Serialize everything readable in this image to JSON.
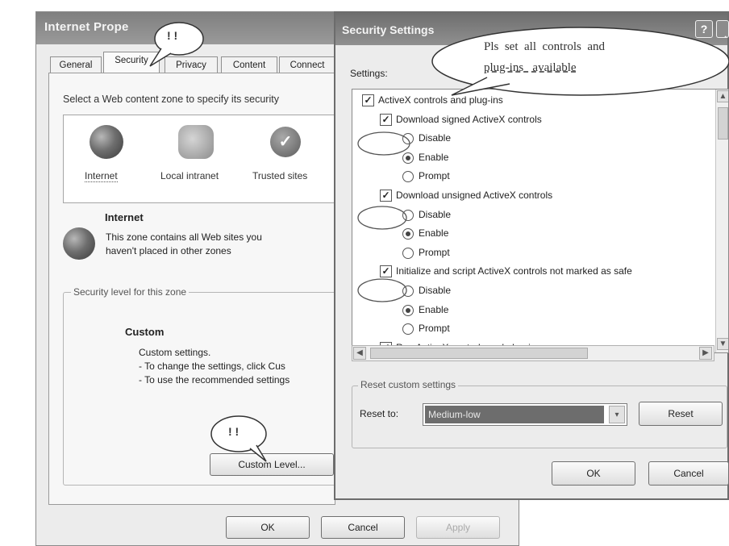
{
  "internet_properties": {
    "title": "Internet Prope",
    "tabs": [
      "General",
      "Security",
      "Privacy",
      "Content",
      "Connect"
    ],
    "active_tab": "Security",
    "zone_instruction": "Select a Web content zone to specify its security",
    "zones": [
      {
        "label": "Internet",
        "icon": "globe-icon"
      },
      {
        "label": "Local intranet",
        "icon": "monitor-icon"
      },
      {
        "label": "Trusted sites",
        "icon": "checkmark-icon"
      }
    ],
    "zone_heading": "Internet",
    "zone_description_line1": "This zone contains all Web sites you",
    "zone_description_line2": "haven't placed in other zones",
    "security_level_group": "Security level for this zone",
    "level_name": "Custom",
    "level_line1": "Custom settings.",
    "level_line2": "- To change the settings, click Cus",
    "level_line3": "- To use the recommended settings",
    "custom_level_button": "Custom Level...",
    "ok_button": "OK",
    "cancel_button": "Cancel",
    "apply_button": "Apply"
  },
  "security_settings": {
    "title": "Security Settings",
    "help_button": "?",
    "settings_label": "Settings:",
    "list": [
      {
        "kind": "category",
        "label": "ActiveX controls and plug-ins",
        "checked": true
      },
      {
        "kind": "item",
        "label": "Download signed ActiveX controls",
        "checked": true
      },
      {
        "kind": "option",
        "label": "Disable",
        "selected": false
      },
      {
        "kind": "option",
        "label": "Enable",
        "selected": true
      },
      {
        "kind": "option",
        "label": "Prompt",
        "selected": false
      },
      {
        "kind": "item",
        "label": "Download unsigned ActiveX controls",
        "checked": true
      },
      {
        "kind": "option",
        "label": "Disable",
        "selected": false
      },
      {
        "kind": "option",
        "label": "Enable",
        "selected": true
      },
      {
        "kind": "option",
        "label": "Prompt",
        "selected": false
      },
      {
        "kind": "item",
        "label": "Initialize and script ActiveX controls not marked as safe",
        "checked": true
      },
      {
        "kind": "option",
        "label": "Disable",
        "selected": false
      },
      {
        "kind": "option",
        "label": "Enable",
        "selected": true
      },
      {
        "kind": "option",
        "label": "Prompt",
        "selected": false
      },
      {
        "kind": "item",
        "label": "Run ActiveX controls and plug-ins",
        "checked": true
      }
    ],
    "reset_group": "Reset custom settings",
    "reset_to_label": "Reset to:",
    "reset_to_value": "Medium-low",
    "reset_button": "Reset",
    "ok_button": "OK",
    "cancel_button": "Cancel"
  },
  "annotations": {
    "bubble_security_tab": "! !",
    "bubble_custom_level": "! !",
    "bubble_message_line1": "Pls  set  all  controls  and",
    "bubble_message_line2": "plug-ins   available"
  },
  "colors": {
    "title_bar": "#8a8a8a",
    "window_bg": "#ececec",
    "selection": "#6d6d6d"
  }
}
